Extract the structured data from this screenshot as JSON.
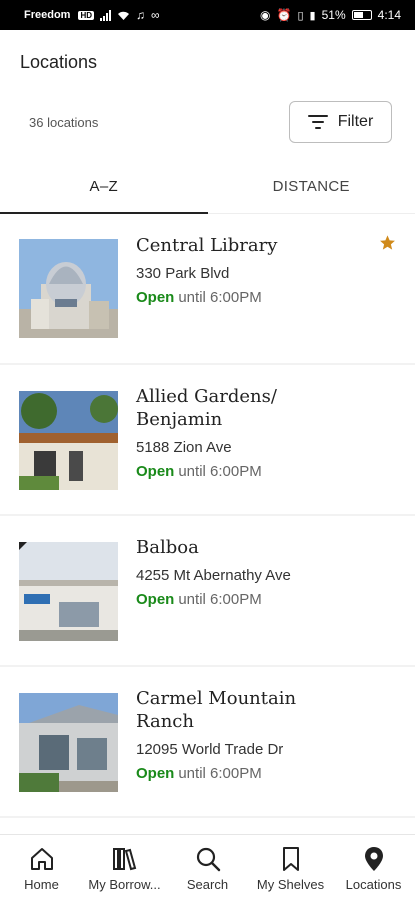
{
  "status_bar": {
    "carrier": "Freedom",
    "carrier_badge": "HD",
    "battery": "51%",
    "time": "4:14"
  },
  "header": {
    "title": "Locations"
  },
  "toolbar": {
    "count_text": "36 locations",
    "filter_label": "Filter"
  },
  "tabs": [
    {
      "label": "A–Z",
      "active": true
    },
    {
      "label": "DISTANCE",
      "active": false
    }
  ],
  "locations": [
    {
      "name": "Central Library",
      "address": "330 Park Blvd",
      "open_label": "Open",
      "hours": "until 6:00PM",
      "favorite": true
    },
    {
      "name": "Allied Gardens/ Benjamin",
      "address": "5188  Zion Ave",
      "open_label": "Open",
      "hours": "until 6:00PM",
      "favorite": false
    },
    {
      "name": "Balboa",
      "address": "4255 Mt Abernathy Ave",
      "open_label": "Open",
      "hours": "until 6:00PM",
      "favorite": false
    },
    {
      "name": "Carmel Mountain Ranch",
      "address": "12095  World Trade Dr",
      "open_label": "Open",
      "hours": "until 6:00PM",
      "favorite": false
    }
  ],
  "colors": {
    "open": "#1a8a1a",
    "favorite_star": "#d08a1a"
  },
  "bottom_nav": [
    {
      "label": "Home",
      "icon": "home-icon"
    },
    {
      "label": "My Borrow...",
      "icon": "books-icon"
    },
    {
      "label": "Search",
      "icon": "search-icon"
    },
    {
      "label": "My Shelves",
      "icon": "bookmark-icon"
    },
    {
      "label": "Locations",
      "icon": "location-pin-icon"
    }
  ]
}
